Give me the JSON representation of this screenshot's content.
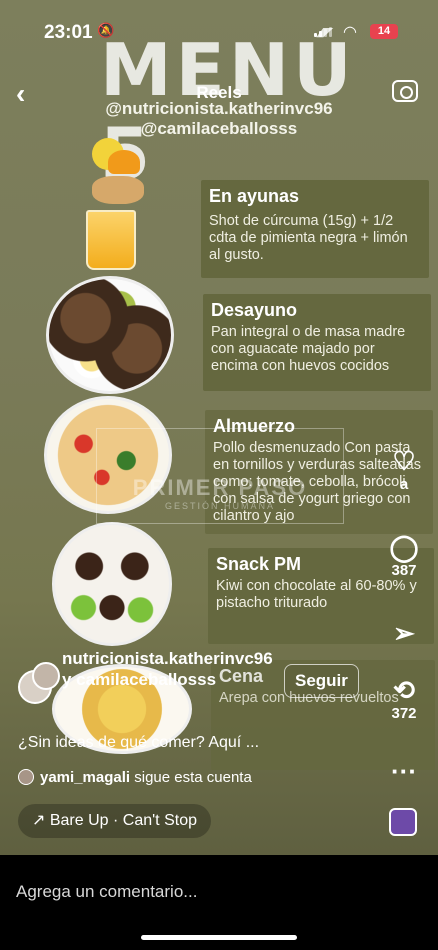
{
  "status": {
    "time": "23:01",
    "battery": "14",
    "icons": [
      "bell-slash-icon",
      "signal-icon",
      "wifi-icon",
      "battery-icon"
    ]
  },
  "header": {
    "title_overlay": "MENÚ 5",
    "reels_label": "Reels",
    "handle_1": "@nutricionista.katherinvc96",
    "handle_2": "@camilaceballosss"
  },
  "menu": [
    {
      "title": "En ayunas",
      "text": "Shot de cúrcuma (15g) + 1/2 cdta de pimienta negra + limón al gusto."
    },
    {
      "title": "Desayuno",
      "text": "Pan integral o de masa madre con aguacate majado por encima con huevos cocidos"
    },
    {
      "title": "Almuerzo",
      "text": "Pollo desmenuzado Con pasta en tornillos y verduras salteadas como: tomate, cebolla, brócoli con salsa de yogurt griego con cilantro y ajo"
    },
    {
      "title": "Snack PM",
      "text": "Kiwi con chocolate al 60-80% y pistacho triturado"
    },
    {
      "title": "Cena",
      "text": "Arepa con huevos revueltos"
    }
  ],
  "watermark": {
    "line1": "PRIMER PASO",
    "line2": "GESTIÓN HUMANA"
  },
  "actions": {
    "like_count": "",
    "like_count_suffix": "a",
    "comment_count": "387",
    "repost_count": "372"
  },
  "post": {
    "author": "nutricionista.katherinvc96 y camilaceballosss",
    "follow_label": "Seguir",
    "caption": "¿Sin ideas de qué comer? Aquí ...",
    "follower_name": "yami_magali",
    "follower_text": "sigue esta cuenta",
    "audio": "Bare Up · Can't Stop"
  },
  "comment": {
    "placeholder": "Agrega un comentario..."
  },
  "colors": {
    "background": "#7b7c58",
    "card": "#65683f",
    "battery": "#e8424f"
  }
}
